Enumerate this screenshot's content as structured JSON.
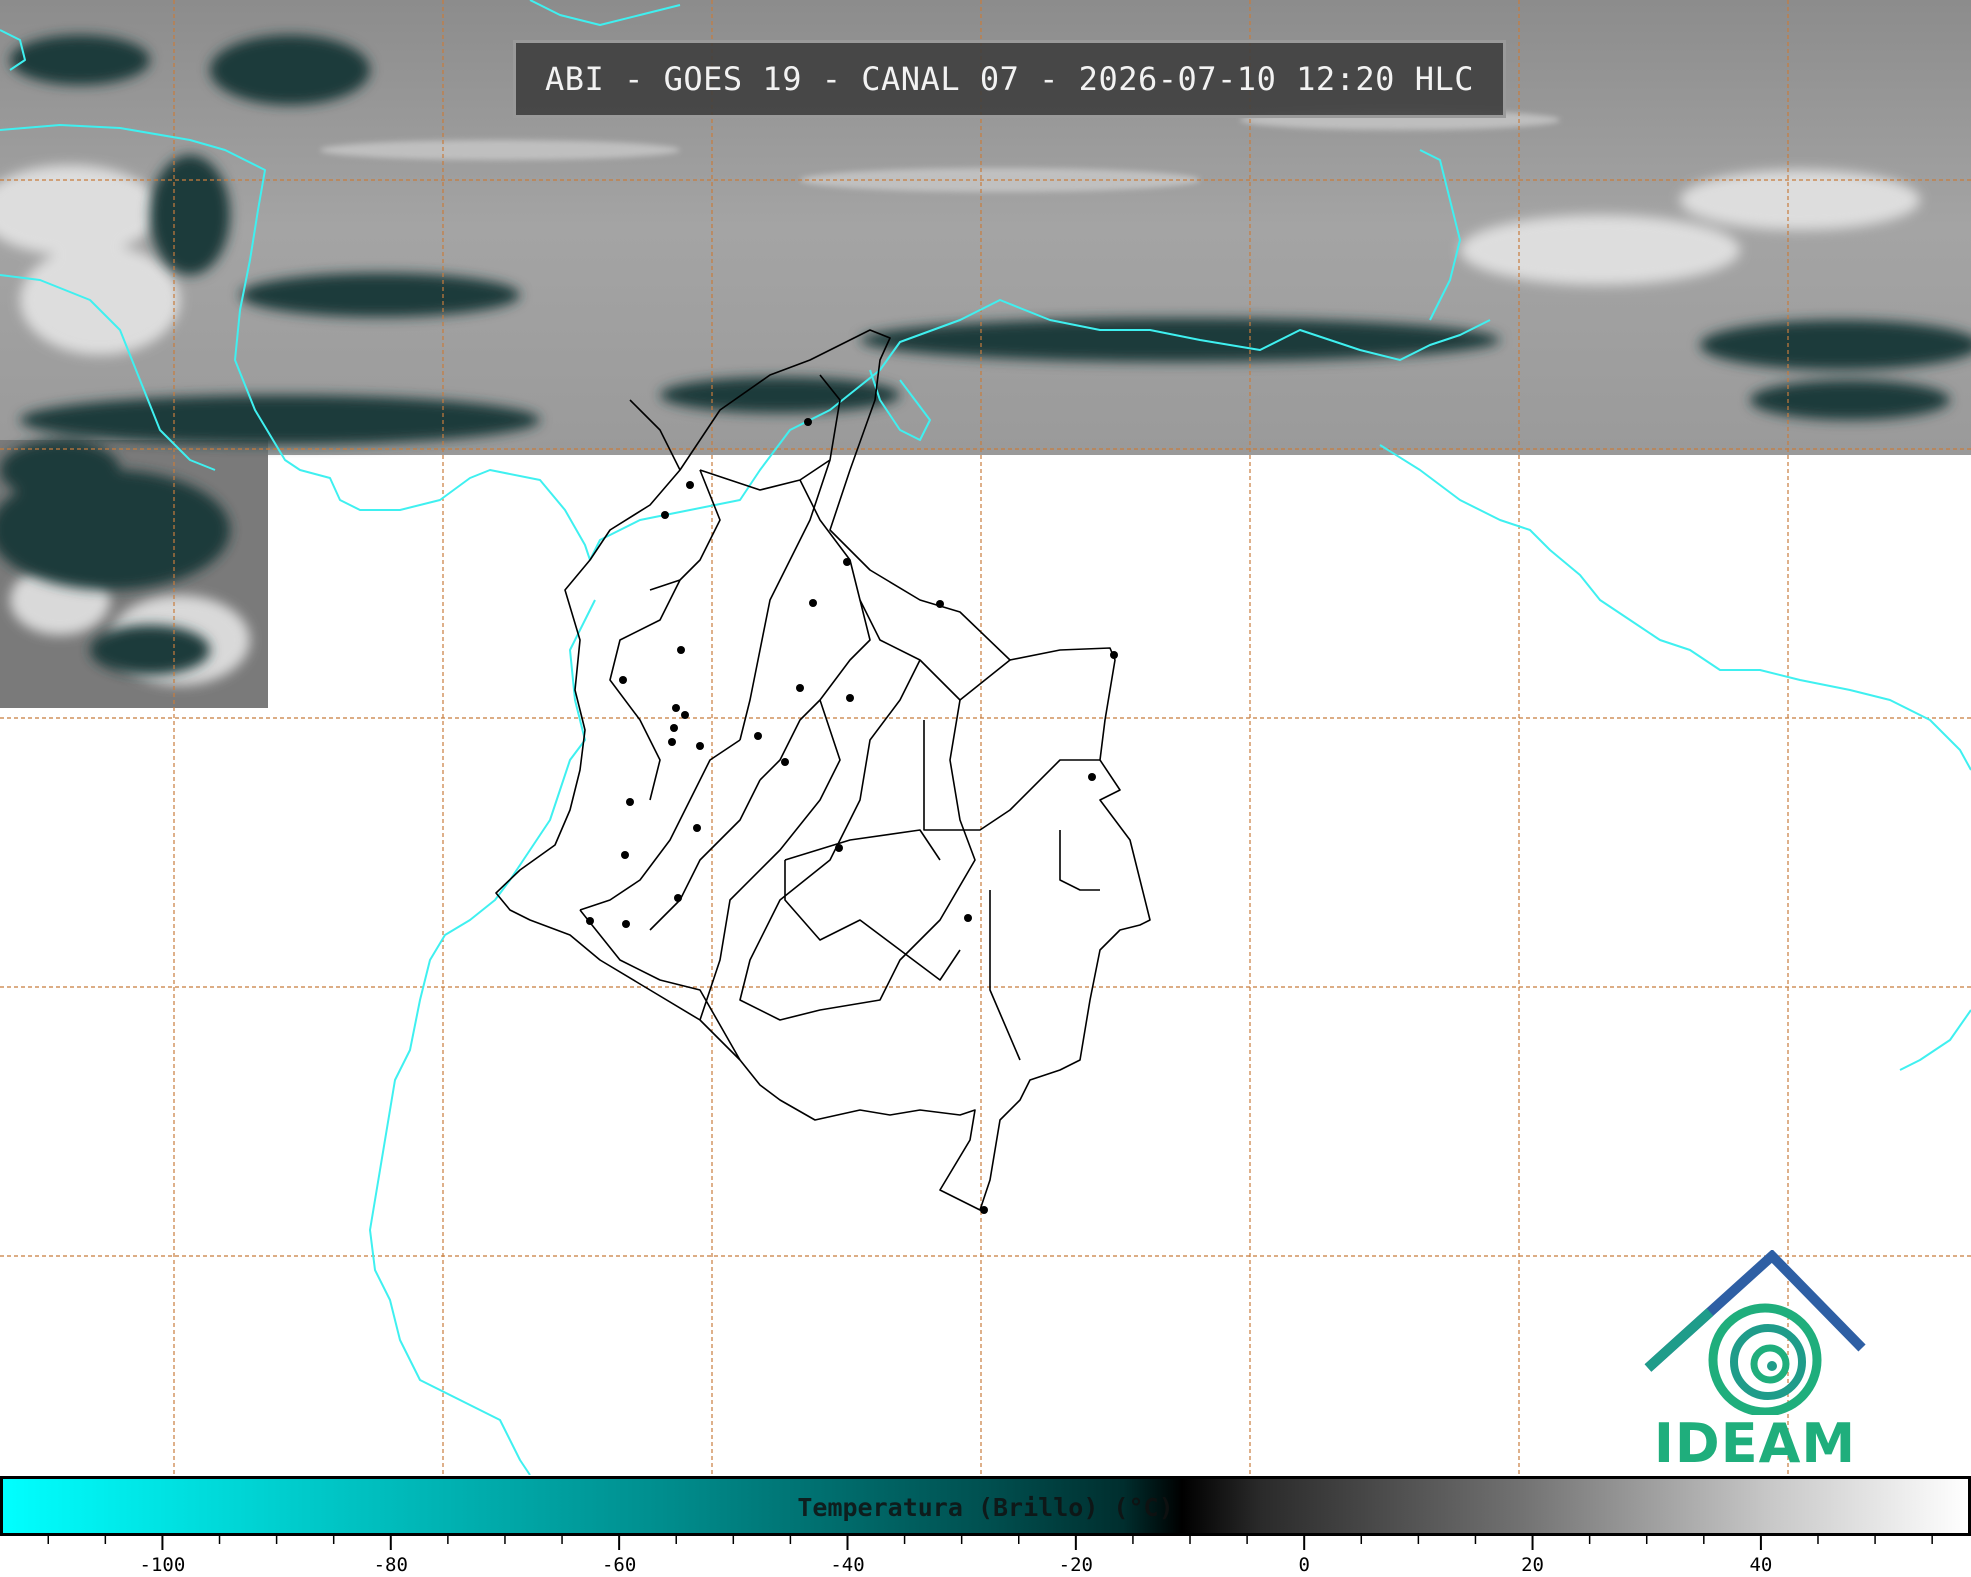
{
  "header": {
    "title": "ABI - GOES 19 - CANAL 07 - 2026-07-10 12:20 HLC"
  },
  "logo": {
    "text": "IDEAM",
    "colors": {
      "roof": "#2e5fa4",
      "swirl": "#1fae7c"
    }
  },
  "colorbar": {
    "label": "Temperatura (Brillo) (°C)",
    "min": -113,
    "max": 57,
    "tick_labels": [
      "-100",
      "-80",
      "-60",
      "-40",
      "-20",
      "0",
      "20",
      "40"
    ],
    "tick_values": [
      -100,
      -80,
      -60,
      -40,
      -20,
      0,
      20,
      40
    ],
    "minor_step": 5,
    "colors": [
      "#00ffff",
      "#008c8c",
      "#002e2e",
      "#000000",
      "#707070",
      "#ffffff"
    ]
  },
  "map": {
    "coastline_color": "#3ff0f0",
    "grid_color": "#c87c3c",
    "borders_color": "#000000",
    "satellite_colors": [
      "#9a9a9a",
      "#1f3c3c",
      "#e6e6e6"
    ]
  }
}
